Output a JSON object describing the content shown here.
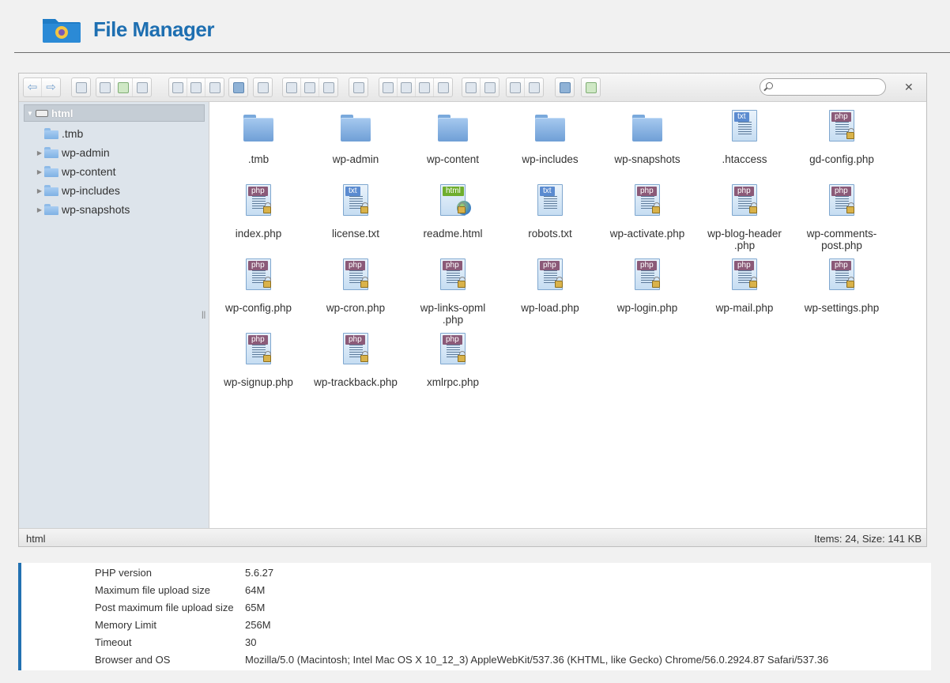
{
  "header": {
    "title": "File Manager",
    "logo_icon": "folder-gear-icon",
    "accent": "#1e6fb1"
  },
  "toolbar": {
    "groups": [
      [
        "back-icon",
        "forward-icon"
      ],
      [
        "netmount-icon"
      ],
      [
        "mkdir-icon",
        "mkfile-icon",
        "upload-icon"
      ],
      [
        "open-icon",
        "download-icon",
        "select-icon"
      ],
      [
        "info-icon"
      ],
      [
        "quicklook-icon"
      ],
      [
        "copy-icon",
        "cut-icon",
        "paste-icon"
      ],
      [
        "rm-icon"
      ],
      [
        "duplicate-icon",
        "rename-icon",
        "edit-icon",
        "resize-icon"
      ],
      [
        "extract-icon",
        "archive-icon"
      ],
      [
        "view-icon",
        "sort-icon"
      ],
      [
        "help-icon"
      ],
      [
        "fullscreen-icon"
      ]
    ],
    "search_placeholder": ""
  },
  "tree": {
    "root": "html",
    "items": [
      {
        "label": ".tmb",
        "expandable": false
      },
      {
        "label": "wp-admin",
        "expandable": true
      },
      {
        "label": "wp-content",
        "expandable": true
      },
      {
        "label": "wp-includes",
        "expandable": true
      },
      {
        "label": "wp-snapshots",
        "expandable": true
      }
    ]
  },
  "files": [
    {
      "name": ".tmb",
      "kind": "folder",
      "locked": false
    },
    {
      "name": "wp-admin",
      "kind": "folder",
      "locked": true
    },
    {
      "name": "wp-content",
      "kind": "folder",
      "locked": false
    },
    {
      "name": "wp-includes",
      "kind": "folder",
      "locked": true
    },
    {
      "name": "wp-snapshots",
      "kind": "folder",
      "locked": false
    },
    {
      "name": ".htaccess",
      "kind": "txt",
      "locked": false
    },
    {
      "name": "gd-config.php",
      "kind": "php",
      "locked": true
    },
    {
      "name": "index.php",
      "kind": "php",
      "locked": true
    },
    {
      "name": "license.txt",
      "kind": "txt",
      "locked": true
    },
    {
      "name": "readme.html",
      "kind": "html",
      "locked": true
    },
    {
      "name": "robots.txt",
      "kind": "txt",
      "locked": false
    },
    {
      "name": "wp-activate.php",
      "kind": "php",
      "locked": true
    },
    {
      "name": "wp-blog-header\n.php",
      "kind": "php",
      "locked": true
    },
    {
      "name": "wp-comments-\npost.php",
      "kind": "php",
      "locked": true
    },
    {
      "name": "wp-config.php",
      "kind": "php",
      "locked": true
    },
    {
      "name": "wp-cron.php",
      "kind": "php",
      "locked": true
    },
    {
      "name": "wp-links-opml\n.php",
      "kind": "php",
      "locked": true
    },
    {
      "name": "wp-load.php",
      "kind": "php",
      "locked": true
    },
    {
      "name": "wp-login.php",
      "kind": "php",
      "locked": true
    },
    {
      "name": "wp-mail.php",
      "kind": "php",
      "locked": true
    },
    {
      "name": "wp-settings.php",
      "kind": "php",
      "locked": true
    },
    {
      "name": "wp-signup.php",
      "kind": "php",
      "locked": true
    },
    {
      "name": "wp-trackback.php",
      "kind": "php",
      "locked": true
    },
    {
      "name": "xmlrpc.php",
      "kind": "php",
      "locked": true
    }
  ],
  "tags": {
    "php": "php",
    "txt": "txt",
    "html": "html"
  },
  "statusbar": {
    "path": "html",
    "info": "Items: 24, Size: 141 KB"
  },
  "sysinfo": [
    {
      "key": "PHP version",
      "value": "5.6.27"
    },
    {
      "key": "Maximum file upload size",
      "value": "64M"
    },
    {
      "key": "Post maximum file upload size",
      "value": "65M"
    },
    {
      "key": "Memory Limit",
      "value": "256M"
    },
    {
      "key": "Timeout",
      "value": "30"
    },
    {
      "key": "Browser and OS",
      "value": "Mozilla/5.0 (Macintosh; Intel Mac OS X 10_12_3) AppleWebKit/537.36 (KHTML, like Gecko) Chrome/56.0.2924.87 Safari/537.36"
    }
  ]
}
